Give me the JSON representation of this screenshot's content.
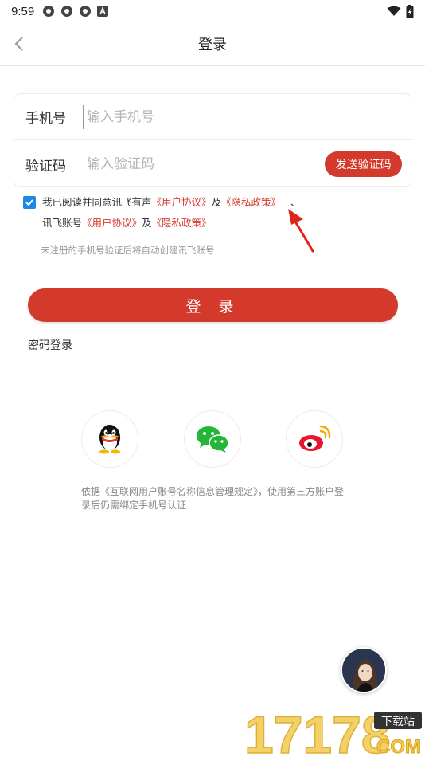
{
  "status_bar": {
    "time": "9:59"
  },
  "header": {
    "title": "登录"
  },
  "form": {
    "phone_label": "手机号",
    "phone_placeholder": "输入手机号",
    "code_label": "验证码",
    "code_placeholder": "输入验证码",
    "send_code_label": "发送验证码"
  },
  "agreement": {
    "text1": "我已阅读并同意讯飞有声",
    "link1": "《用户协议》",
    "and1": "及",
    "link2": "《隐私政策》",
    "sep": "、",
    "text2": "讯飞账号",
    "link3": "《用户协议》",
    "and2": "及",
    "link4": "《隐私政策》",
    "note": "未注册的手机号验证后将自动创建讯飞账号",
    "checked": true
  },
  "login_button": "登 录",
  "password_login": "密码登录",
  "social": [
    "qq-icon",
    "wechat-icon",
    "weibo-icon"
  ],
  "disclaimer": "依据《互联网用户账号名称信息管理规定》，使用第三方账户登录后仍需绑定手机号认证",
  "watermark": {
    "number": "17178",
    "tag": "下载站",
    "suffix": "COM"
  },
  "colors": {
    "accent": "#d43a2c",
    "checkbox": "#1e88e5",
    "link": "#d43a2c"
  }
}
